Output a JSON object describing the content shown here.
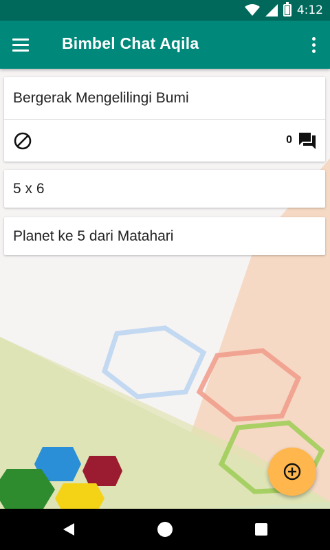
{
  "status_bar": {
    "time": "4:12"
  },
  "app_bar": {
    "title": "Bimbel Chat Aqila"
  },
  "cards": [
    {
      "title": "Bergerak Mengelilingi Bumi",
      "comment_count": "0"
    },
    {
      "title": "5 x 6"
    },
    {
      "title": "Planet ke 5 dari Matahari"
    }
  ],
  "colors": {
    "app_bar": "#00897b",
    "status_bar": "#00695c",
    "fab": "#ffb74d"
  },
  "icons": {
    "menu": "hamburger-icon",
    "more": "more-vert-icon",
    "ban": "block-icon",
    "comments": "forum-icon",
    "fab": "add-circle-icon",
    "nav_back": "back-triangle-icon",
    "nav_home": "home-circle-icon",
    "nav_recent": "recent-square-icon"
  }
}
